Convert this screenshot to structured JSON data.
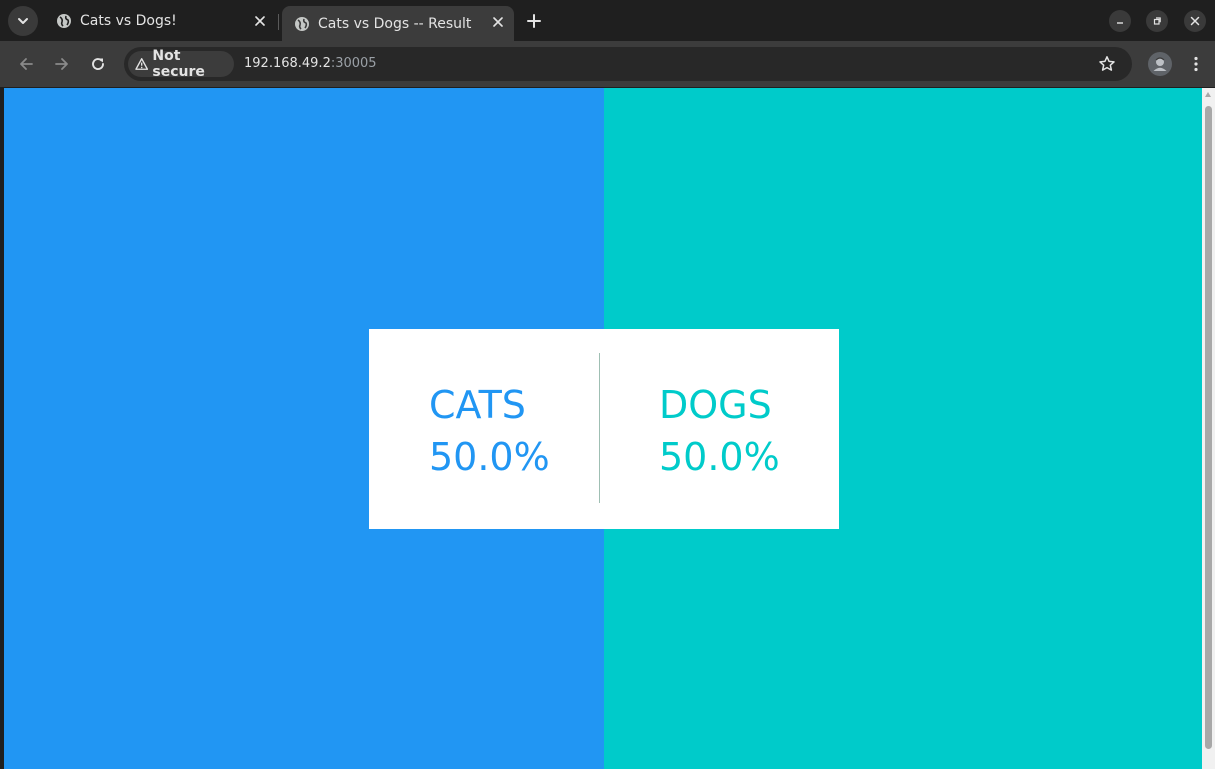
{
  "browser": {
    "tabs": [
      {
        "title": "Cats vs Dogs!",
        "active": false
      },
      {
        "title": "Cats vs Dogs -- Result",
        "active": true
      }
    ],
    "security_label": "Not secure",
    "url_host": "192.168.49.2",
    "url_port": ":30005"
  },
  "result": {
    "cats_label": "CATS",
    "cats_percent": "50.0%",
    "dogs_label": "DOGS",
    "dogs_percent": "50.0%"
  },
  "colors": {
    "cats": "#2196f3",
    "dogs": "#00cbca",
    "card": "#ffffff",
    "browser_chrome": "#1f1f1f"
  },
  "icons": [
    "tab-search-icon",
    "globe-icon",
    "close-icon",
    "plus-icon",
    "minimize-icon",
    "restore-icon",
    "back-icon",
    "forward-icon",
    "reload-icon",
    "warning-icon",
    "star-icon",
    "profile-icon",
    "more-menu-icon"
  ]
}
